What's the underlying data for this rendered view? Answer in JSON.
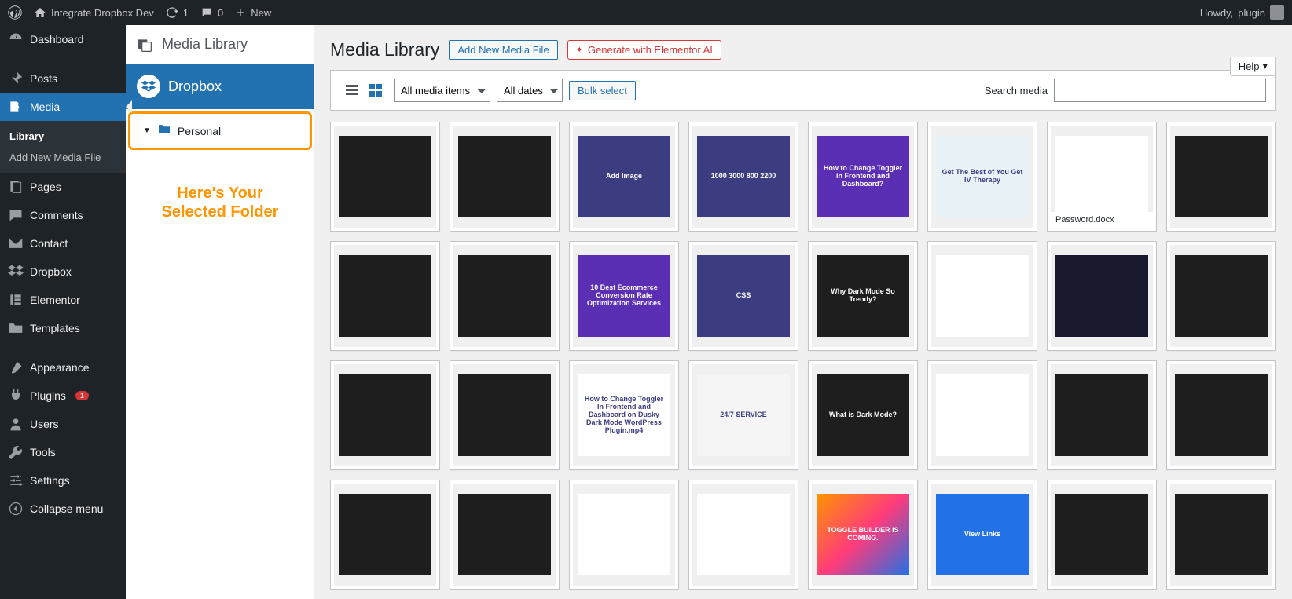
{
  "adminbar": {
    "site_name": "Integrate Dropbox Dev",
    "update_count": "1",
    "comment_count": "0",
    "new_label": "New",
    "howdy_prefix": "Howdy, ",
    "user": "plugin"
  },
  "wp_sidebar": {
    "items": [
      {
        "key": "dashboard",
        "label": "Dashboard",
        "icon": "dashboard"
      },
      {
        "key": "posts",
        "label": "Posts",
        "icon": "pin"
      },
      {
        "key": "media",
        "label": "Media",
        "icon": "media",
        "current": true,
        "submenu": [
          {
            "key": "library",
            "label": "Library",
            "current": true
          },
          {
            "key": "addnew",
            "label": "Add New Media File"
          }
        ]
      },
      {
        "key": "pages",
        "label": "Pages",
        "icon": "pages"
      },
      {
        "key": "comments",
        "label": "Comments",
        "icon": "comment"
      },
      {
        "key": "contact",
        "label": "Contact",
        "icon": "mail"
      },
      {
        "key": "dropbox",
        "label": "Dropbox",
        "icon": "dropbox"
      },
      {
        "key": "elementor",
        "label": "Elementor",
        "icon": "elementor"
      },
      {
        "key": "templates",
        "label": "Templates",
        "icon": "folder"
      },
      {
        "key": "appearance",
        "label": "Appearance",
        "icon": "brush"
      },
      {
        "key": "plugins",
        "label": "Plugins",
        "icon": "plug",
        "badge": "1"
      },
      {
        "key": "users",
        "label": "Users",
        "icon": "user"
      },
      {
        "key": "tools",
        "label": "Tools",
        "icon": "wrench"
      },
      {
        "key": "settings",
        "label": "Settings",
        "icon": "sliders"
      },
      {
        "key": "collapse",
        "label": "Collapse menu",
        "icon": "collapse"
      }
    ]
  },
  "dbx_panel": {
    "heading": "Media Library",
    "root_label": "Dropbox",
    "folder_label": "Personal",
    "annotation_line1": "Here's Your",
    "annotation_line2": "Selected Folder"
  },
  "main": {
    "title": "Media Library",
    "add_new_btn": "Add New Media File",
    "ai_btn": "Generate with Elementor AI",
    "help_label": "Help",
    "filter_media": "All media items",
    "filter_dates": "All dates",
    "bulk_select": "Bulk select",
    "search_label": "Search media"
  },
  "tiles": [
    {
      "bg": "#1e1e1e",
      "txt": ""
    },
    {
      "bg": "#1e1e1e",
      "txt": ""
    },
    {
      "bg": "#3c3c80",
      "txt": "Add Image"
    },
    {
      "bg": "#3c3c80",
      "txt": "1000  3000  800  2200"
    },
    {
      "bg": "#5b2fb3",
      "txt": "How to Change Toggler in Frontend and Dashboard?"
    },
    {
      "bg": "#e8f2f7",
      "txt": "Get The Best of You Get IV Therapy",
      "dark": true
    },
    {
      "bg": "#ffffff",
      "txt": "",
      "label": "Password.docx"
    },
    {
      "bg": "#1e1e1e",
      "txt": ""
    },
    {
      "bg": "#1e1e1e",
      "txt": ""
    },
    {
      "bg": "#1e1e1e",
      "txt": ""
    },
    {
      "bg": "#5b2fb3",
      "txt": "10 Best Ecommerce Conversion Rate Optimization Services"
    },
    {
      "bg": "#3c3c80",
      "txt": "CSS"
    },
    {
      "bg": "#1e1e1e",
      "txt": "Why Dark Mode So Trendy?"
    },
    {
      "bg": "#ffffff",
      "txt": ""
    },
    {
      "bg": "#1a1a2e",
      "txt": ""
    },
    {
      "bg": "#1e1e1e",
      "txt": ""
    },
    {
      "bg": "#1e1e1e",
      "txt": ""
    },
    {
      "bg": "#1e1e1e",
      "txt": ""
    },
    {
      "bg": "#ffffff",
      "txt": "How to Change Toggler In Frontend and Dashboard on Dusky Dark Mode WordPress Plugin.mp4",
      "dark": true
    },
    {
      "bg": "#f5f5f5",
      "txt": "24/7 SERVICE",
      "dark": true
    },
    {
      "bg": "#1e1e1e",
      "txt": "What is Dark Mode?"
    },
    {
      "bg": "#ffffff",
      "txt": ""
    },
    {
      "bg": "#1e1e1e",
      "txt": ""
    },
    {
      "bg": "#1e1e1e",
      "txt": ""
    },
    {
      "bg": "#1e1e1e",
      "txt": ""
    },
    {
      "bg": "#1e1e1e",
      "txt": ""
    },
    {
      "bg": "#ffffff",
      "txt": "",
      "dark": true
    },
    {
      "bg": "#ffffff",
      "txt": "",
      "dark": true
    },
    {
      "bg": "#fefefe",
      "txt": "TOGGLE BUILDER IS COMING.",
      "grad": true
    },
    {
      "bg": "#2271e6",
      "txt": "View Links"
    },
    {
      "bg": "#1e1e1e",
      "txt": ""
    },
    {
      "bg": "#1e1e1e",
      "txt": ""
    }
  ]
}
